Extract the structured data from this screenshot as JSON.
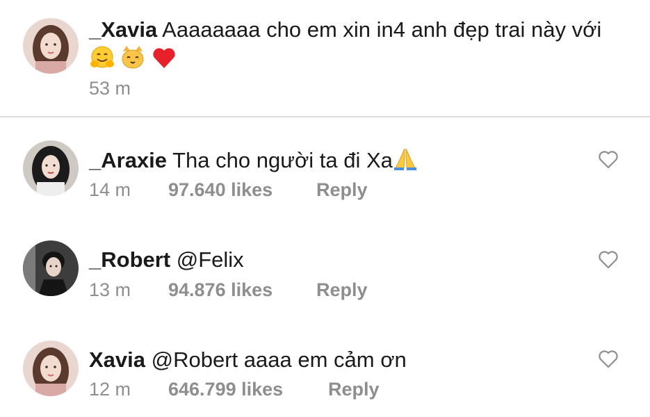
{
  "caption": {
    "username": "_Xavia",
    "text": "Aaaaaaaa cho em xin in4 anh đẹp trai này với",
    "emojis": [
      "hugging-face-emoji",
      "cat-face-emoji",
      "red-heart-emoji"
    ],
    "time": "53 m"
  },
  "comments": [
    {
      "username": "_Araxie",
      "text": "Tha cho người ta đi Xa",
      "trailing_emoji": "folded-hands-emoji",
      "time": "14 m",
      "likes": "97.640 likes",
      "reply": "Reply"
    },
    {
      "username": "_Robert",
      "text": "@Felix",
      "time": "13 m",
      "likes": "94.876 likes",
      "reply": "Reply"
    },
    {
      "username": "Xavia",
      "text": "@Robert aaaa em cảm ơn",
      "time": "12 m",
      "likes": "646.799 likes",
      "reply": "Reply"
    }
  ],
  "colors": {
    "text": "#1a1a1a",
    "muted": "#8e8e8e",
    "divider": "#dcdcdc",
    "heart_outline": "#8e8e8e"
  }
}
